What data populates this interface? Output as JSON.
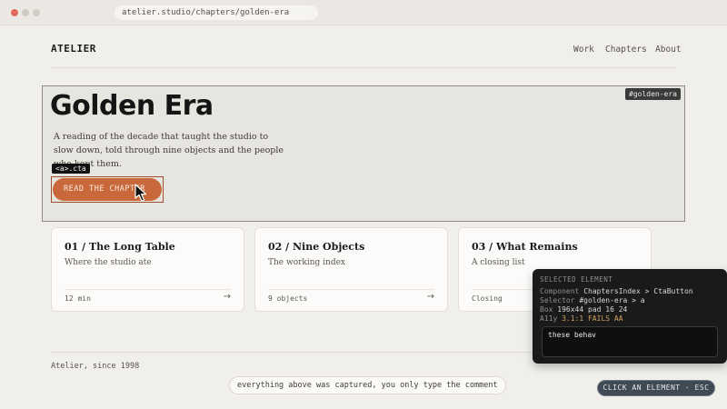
{
  "browser": {
    "url": "atelier.studio/chapters/golden-era"
  },
  "site": {
    "logo": "ATELIER",
    "nav": [
      "Work",
      "Chapters",
      "About"
    ]
  },
  "hero": {
    "id_tag": "#golden-era",
    "title": "Golden Era",
    "description": "A reading of the decade that taught the studio to slow down, told through nine objects and the people who kept them.",
    "cta_tag": "<a>.cta",
    "cta_label": "READ THE CHAPTER"
  },
  "cards": [
    {
      "title": "01 / The Long Table",
      "subtitle": "Where the studio ate",
      "meta": "12 min",
      "arrow": "→"
    },
    {
      "title": "02 / Nine Objects",
      "subtitle": "The working index",
      "meta": "9 objects",
      "arrow": "→"
    },
    {
      "title": "03 / What Remains",
      "subtitle": "A closing list",
      "meta": "Closing",
      "arrow": "→"
    }
  ],
  "footer": {
    "text": "Atelier, since 1998"
  },
  "caption": "everything above was captured, you only type the comment",
  "inspector": {
    "heading": "SELECTED ELEMENT",
    "component_label": "Component",
    "component_value": "ChaptersIndex > CtaButton",
    "selector_label": "Selector",
    "selector_value": "#golden-era > a",
    "box_label": "Box",
    "box_value": "196x44 pad 16 24",
    "a11y_label": "A11y",
    "a11y_value": "3.1:1 FAILS AA",
    "comment_value": "these behav"
  },
  "pick_button": "CLICK AN ELEMENT · ESC",
  "colors": {
    "accent": "#c9683a",
    "panel": "#1a1a1a",
    "fail": "#d0a063"
  }
}
